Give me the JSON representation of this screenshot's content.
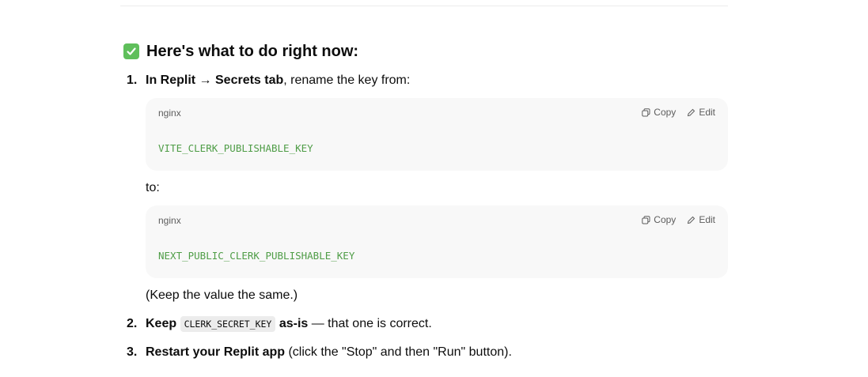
{
  "heading": {
    "icon": "check-mark-button-icon",
    "text": "Here's what to do right now:"
  },
  "steps": [
    {
      "number": "1.",
      "bold": "In Replit → Secrets tab",
      "rest": ", rename the key from:",
      "code_from": {
        "lang": "nginx",
        "copy": "Copy",
        "edit": "Edit",
        "code": "VITE_CLERK_PUBLISHABLE_KEY"
      },
      "to_label": "to:",
      "code_to": {
        "lang": "nginx",
        "copy": "Copy",
        "edit": "Edit",
        "code": "NEXT_PUBLIC_CLERK_PUBLISHABLE_KEY"
      },
      "note": "(Keep the value the same.)"
    },
    {
      "number": "2.",
      "bold_keep": "Keep",
      "inline_code": "CLERK_SECRET_KEY",
      "bold_asis": "as-is",
      "rest": " — that one is correct."
    },
    {
      "number": "3.",
      "bold": "Restart your Replit app",
      "rest": " (click the \"Stop\" and then \"Run\" button)."
    }
  ],
  "colors": {
    "code_green": "#4f9d47",
    "code_bg": "#f8f8f8",
    "check_green": "#5fbf5b"
  }
}
